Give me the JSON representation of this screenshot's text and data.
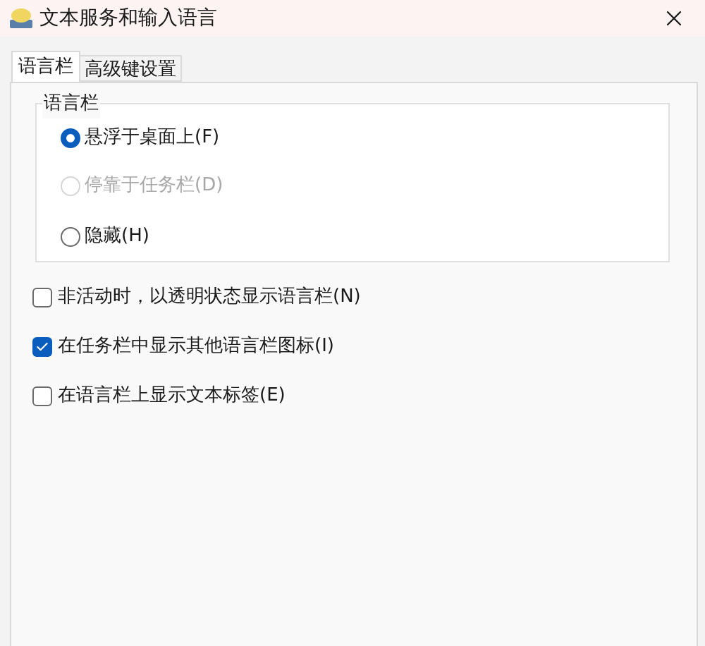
{
  "window": {
    "title": "文本服务和输入语言"
  },
  "tabs": [
    {
      "label": "语言栏",
      "selected": true
    },
    {
      "label": "高级键设置",
      "selected": false
    }
  ],
  "group": {
    "title": "语言栏",
    "options": [
      {
        "label": "悬浮于桌面上(F)",
        "selected": true,
        "disabled": false
      },
      {
        "label": "停靠于任务栏(D)",
        "selected": false,
        "disabled": true
      },
      {
        "label": "隐藏(H)",
        "selected": false,
        "disabled": false
      }
    ]
  },
  "checkboxes": [
    {
      "label": "非活动时，以透明状态显示语言栏(N)",
      "checked": false
    },
    {
      "label": "在任务栏中显示其他语言栏图标(I)",
      "checked": true
    },
    {
      "label": "在语言栏上显示文本标签(E)",
      "checked": false
    }
  ]
}
